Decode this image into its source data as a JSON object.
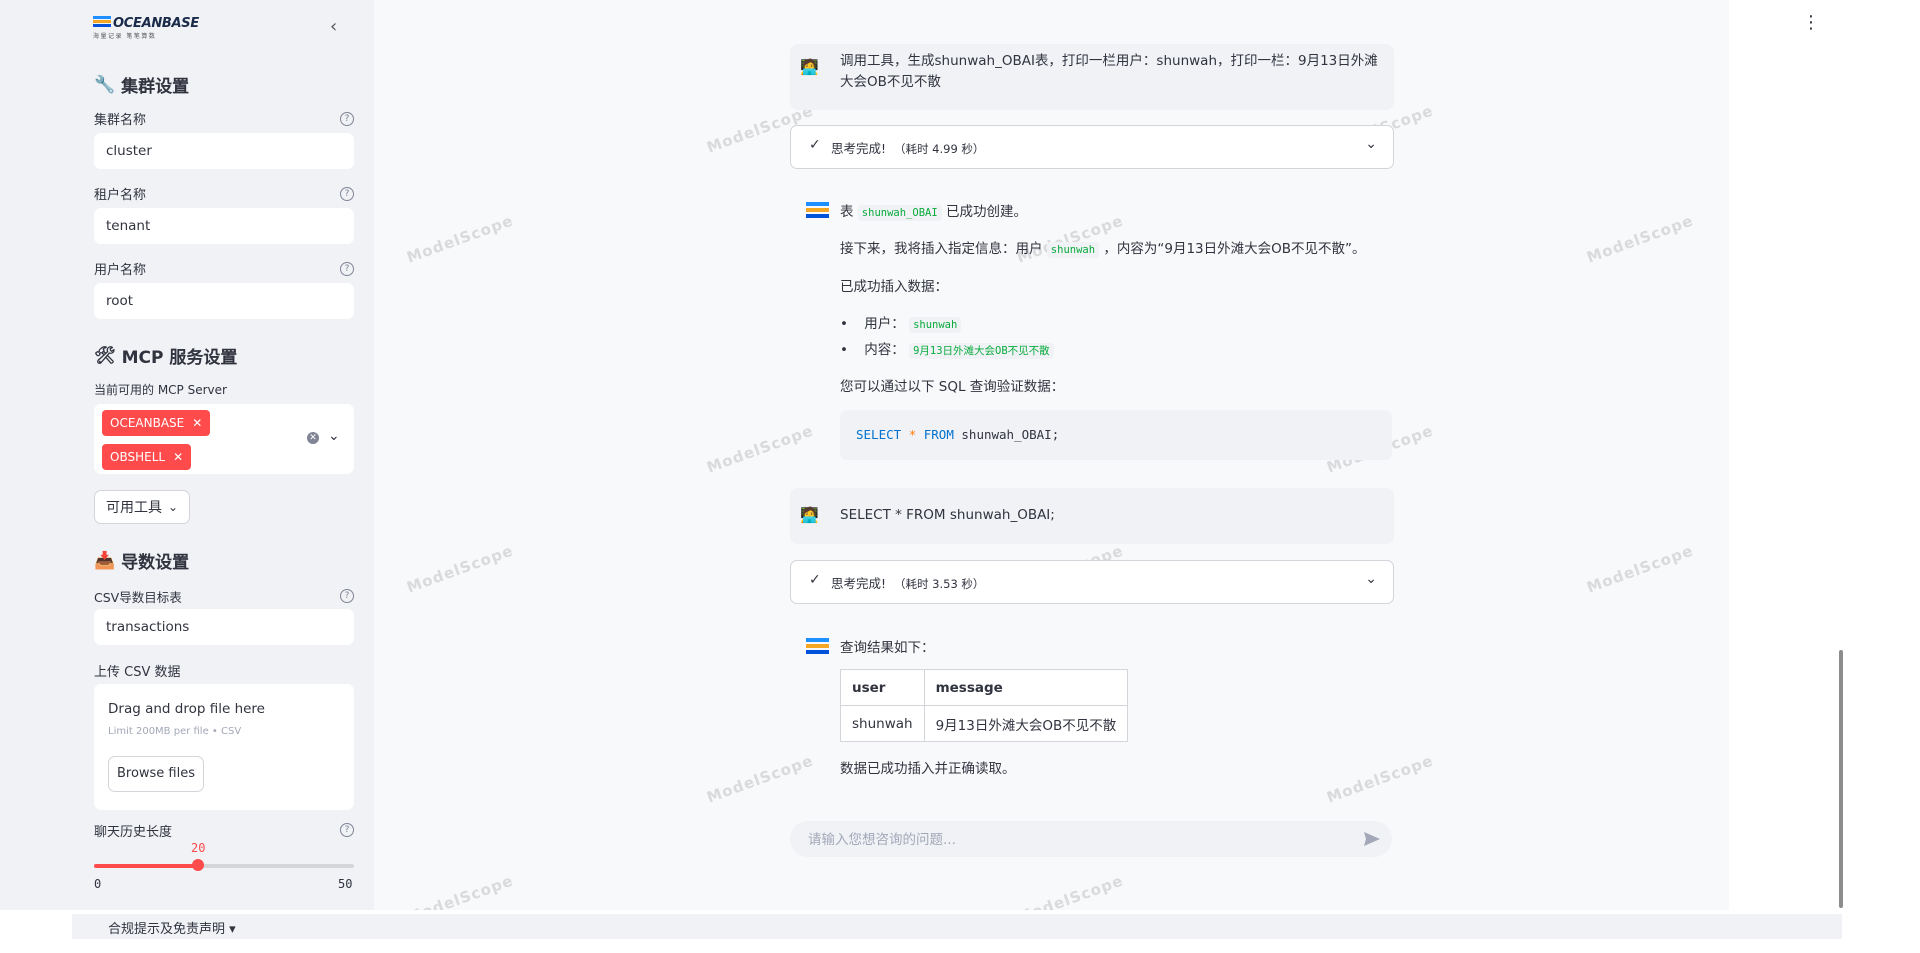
{
  "sidebar": {
    "logo": {
      "word": "OCEANBASE",
      "sub": "海量记录 笔笔算数"
    },
    "cluster_section": {
      "title": "集群设置",
      "cluster_label": "集群名称",
      "cluster_value": "cluster",
      "tenant_label": "租户名称",
      "tenant_value": "tenant",
      "user_label": "用户名称",
      "user_value": "root"
    },
    "mcp_section": {
      "title": "MCP 服务设置",
      "servers_label": "当前可用的 MCP Server",
      "servers": [
        "OCEANBASE",
        "OBSHELL"
      ],
      "tools_button": "可用工具"
    },
    "import_section": {
      "title": "导数设置",
      "table_label": "CSV导数目标表",
      "table_value": "transactions",
      "upload_label": "上传 CSV 数据",
      "dropzone_title": "Drag and drop file here",
      "dropzone_sub": "Limit 200MB per file • CSV",
      "browse_label": "Browse files"
    },
    "history": {
      "label": "聊天历史长度",
      "value": 20,
      "min": 0,
      "max": 50
    }
  },
  "chat": {
    "messages": [
      {
        "role": "user",
        "text": "调用工具，生成shunwah_OBAI表，打印一栏用户：shunwah，打印一栏：9月13日外滩大会OB不见不散"
      },
      {
        "role": "thinking",
        "text": "思考完成!",
        "duration": "（耗时 4.99 秒）"
      },
      {
        "role": "assistant",
        "line1_pre": "表",
        "line1_code": "shunwah_OBAI",
        "line1_post": "已成功创建。",
        "line2_pre": "接下来，我将插入指定信息：用户",
        "line2_code": "shunwah",
        "line2_post": "，内容为“9月13日外滩大会OB不见不散”。",
        "line3": "已成功插入数据：",
        "bullet1_label": "用户：",
        "bullet1_code": "shunwah",
        "bullet2_label": "内容：",
        "bullet2_code": "9月13日外滩大会OB不见不散",
        "line4": "您可以通过以下 SQL 查询验证数据：",
        "sql_kw1": "SELECT",
        "sql_op": "*",
        "sql_kw2": "FROM",
        "sql_rest": "shunwah_OBAI;"
      },
      {
        "role": "user",
        "text": "SELECT * FROM shunwah_OBAI;"
      },
      {
        "role": "thinking",
        "text": "思考完成!",
        "duration": "（耗时 3.53 秒）"
      },
      {
        "role": "assistant",
        "intro": "查询结果如下：",
        "table_headers": [
          "user",
          "message"
        ],
        "table_rows": [
          [
            "shunwah",
            "9月13日外滩大会OB不见不散"
          ]
        ],
        "outro": "数据已成功插入并正确读取。"
      }
    ],
    "input_placeholder": "请输入您想咨询的问题..."
  },
  "watermark": "ModelScope",
  "footer": {
    "label": "合规提示及免责声明 ▾"
  },
  "colors": {
    "accent": "#ff4b4b",
    "code_green": "#09ab3b",
    "sql_keyword": "#0072ce"
  }
}
